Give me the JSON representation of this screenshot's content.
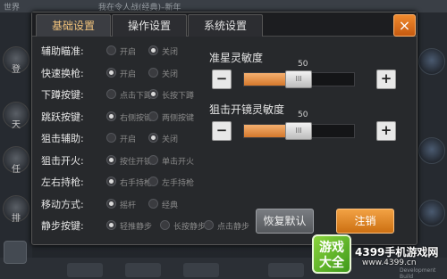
{
  "colors": {
    "accent": "#f2a244",
    "active_tab_text": "#f2c37c",
    "slider_fill": "#d4782c"
  },
  "background": {
    "top_strip_text_left": "世界",
    "top_strip_text_mid": "我在令人战(经典)–新年",
    "left_labels": [
      "登",
      "天",
      "任",
      "排"
    ],
    "dev_label": "Development Build"
  },
  "tabs": [
    {
      "label": "基础设置",
      "active": true
    },
    {
      "label": "操作设置",
      "active": false
    },
    {
      "label": "系统设置",
      "active": false
    }
  ],
  "close_icon": "×",
  "settings": [
    {
      "label": "辅助瞄准:",
      "options": [
        {
          "text": "开启",
          "selected": false
        },
        {
          "text": "关闭",
          "selected": true
        }
      ]
    },
    {
      "label": "快速换枪:",
      "options": [
        {
          "text": "开启",
          "selected": true
        },
        {
          "text": "关闭",
          "selected": false
        }
      ]
    },
    {
      "label": "下蹲按键:",
      "options": [
        {
          "text": "点击下蹲",
          "selected": false
        },
        {
          "text": "长按下蹲",
          "selected": true
        }
      ]
    },
    {
      "label": "跳跃按键:",
      "options": [
        {
          "text": "右侧按键",
          "selected": true
        },
        {
          "text": "两侧按键",
          "selected": false
        }
      ]
    },
    {
      "label": "狙击辅助:",
      "options": [
        {
          "text": "开启",
          "selected": false
        },
        {
          "text": "关闭",
          "selected": true
        }
      ]
    },
    {
      "label": "狙击开火:",
      "options": [
        {
          "text": "按住开镜",
          "selected": true
        },
        {
          "text": "单击开火",
          "selected": false
        }
      ]
    },
    {
      "label": "左右持枪:",
      "options": [
        {
          "text": "右手持枪",
          "selected": true
        },
        {
          "text": "左手持枪",
          "selected": false
        }
      ]
    },
    {
      "label": "移动方式:",
      "options": [
        {
          "text": "摇杆",
          "selected": true
        },
        {
          "text": "经典",
          "selected": false
        }
      ]
    },
    {
      "label": "静步按键:",
      "options": [
        {
          "text": "轻推静步",
          "selected": true
        },
        {
          "text": "长按静步",
          "selected": false
        },
        {
          "text": "点击静步",
          "selected": false
        }
      ]
    }
  ],
  "sliders": [
    {
      "title": "准星灵敏度",
      "value": "50",
      "fill_fraction": 0.4
    },
    {
      "title": "狙击开镜灵敏度",
      "value": "50",
      "fill_fraction": 0.4
    }
  ],
  "slider_buttons": {
    "minus": "−",
    "plus": "+"
  },
  "thumb_grip": "III",
  "buttons": {
    "restore": "恢复默认",
    "logout": "注销"
  },
  "watermark": {
    "logo_top": "游戏",
    "logo_bottom": "大全",
    "main": "4399手机游戏网",
    "url": "www.4399.cn"
  }
}
